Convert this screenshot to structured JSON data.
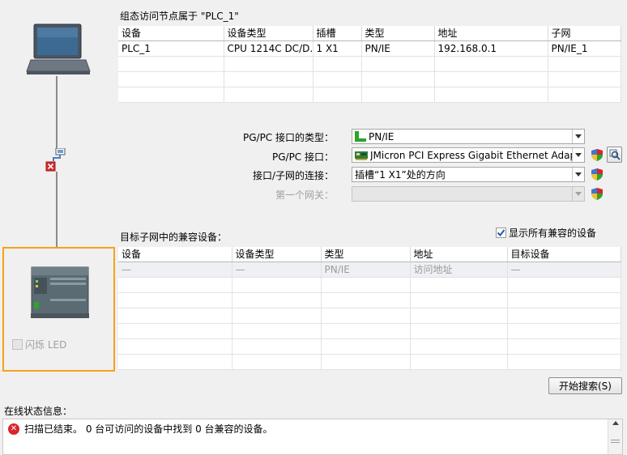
{
  "diagram": {
    "laptop_icon": "laptop-icon",
    "network_icon": "network-error-icon",
    "plc_icon": "plc-device-icon",
    "led_label": "闪烁 LED",
    "led_checked": false
  },
  "node_table": {
    "title": "组态访问节点属于 \"PLC_1\"",
    "columns": [
      "设备",
      "设备类型",
      "插槽",
      "类型",
      "地址",
      "子网"
    ],
    "rows": [
      [
        "PLC_1",
        "CPU 1214C DC/D...",
        "1 X1",
        "PN/IE",
        "192.168.0.1",
        "PN/IE_1"
      ]
    ]
  },
  "interface_form": {
    "type_label": "PG/PC 接口的类型：",
    "type_value": "PN/IE",
    "iface_label": "PG/PC 接口：",
    "iface_value": "JMicron PCI Express Gigabit Ethernet Adapter",
    "conn_label": "接口/子网的连接：",
    "conn_value": "插槽“1 X1”处的方向",
    "gateway_label": "第一个网关：",
    "gateway_value": ""
  },
  "target_table": {
    "title": "目标子网中的兼容设备：",
    "show_all_label": "显示所有兼容的设备",
    "show_all_checked": true,
    "columns": [
      "设备",
      "设备类型",
      "类型",
      "地址",
      "目标设备"
    ],
    "rows": [
      [
        "—",
        "—",
        "PN/IE",
        "访问地址",
        "—"
      ]
    ]
  },
  "search_button": "开始搜索(S)",
  "status": {
    "title": "在线状态信息：",
    "message": "扫描已结束。 0 台可访问的设备中找到 0 台兼容的设备。"
  },
  "colors": {
    "frame_highlight": "#f5a31a",
    "error_red": "#d9262b",
    "pn_green": "#2aa52a"
  }
}
